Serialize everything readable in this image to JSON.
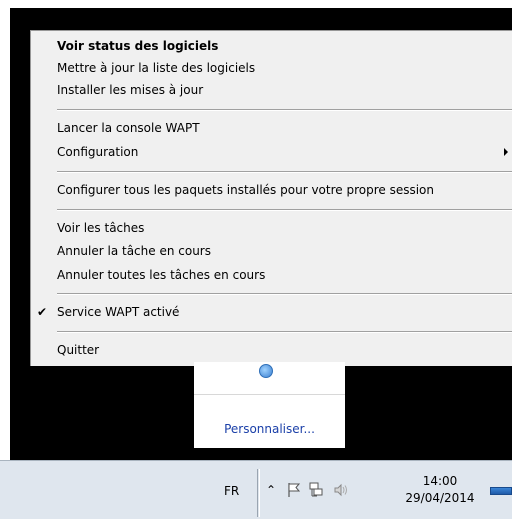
{
  "menu": {
    "items": [
      {
        "label": "Voir status des logiciels",
        "bold": true
      },
      {
        "label": "Mettre à jour la liste des logiciels"
      },
      {
        "label": "Installer les mises à jour"
      },
      {
        "label": "Lancer la console WAPT"
      },
      {
        "label": "Configuration",
        "submenu": true
      },
      {
        "label": "Configurer tous les paquets installés pour votre propre session"
      },
      {
        "label": "Voir les tâches"
      },
      {
        "label": "Annuler la tâche en cours"
      },
      {
        "label": "Annuler toutes les tâches en cours"
      },
      {
        "label": "Service WAPT activé",
        "checked": true,
        "check_mark": "✔"
      },
      {
        "label": "Quitter"
      }
    ]
  },
  "overflow_panel": {
    "customize_label": "Personnaliser..."
  },
  "taskbar": {
    "language": "FR",
    "overflow_glyph": "⌃",
    "time": "14:00",
    "date": "29/04/2014"
  },
  "colors": {
    "menu_bg": "#f0f0f0",
    "taskbar_bg": "#dfe6ee",
    "link": "#1a3fa8"
  }
}
